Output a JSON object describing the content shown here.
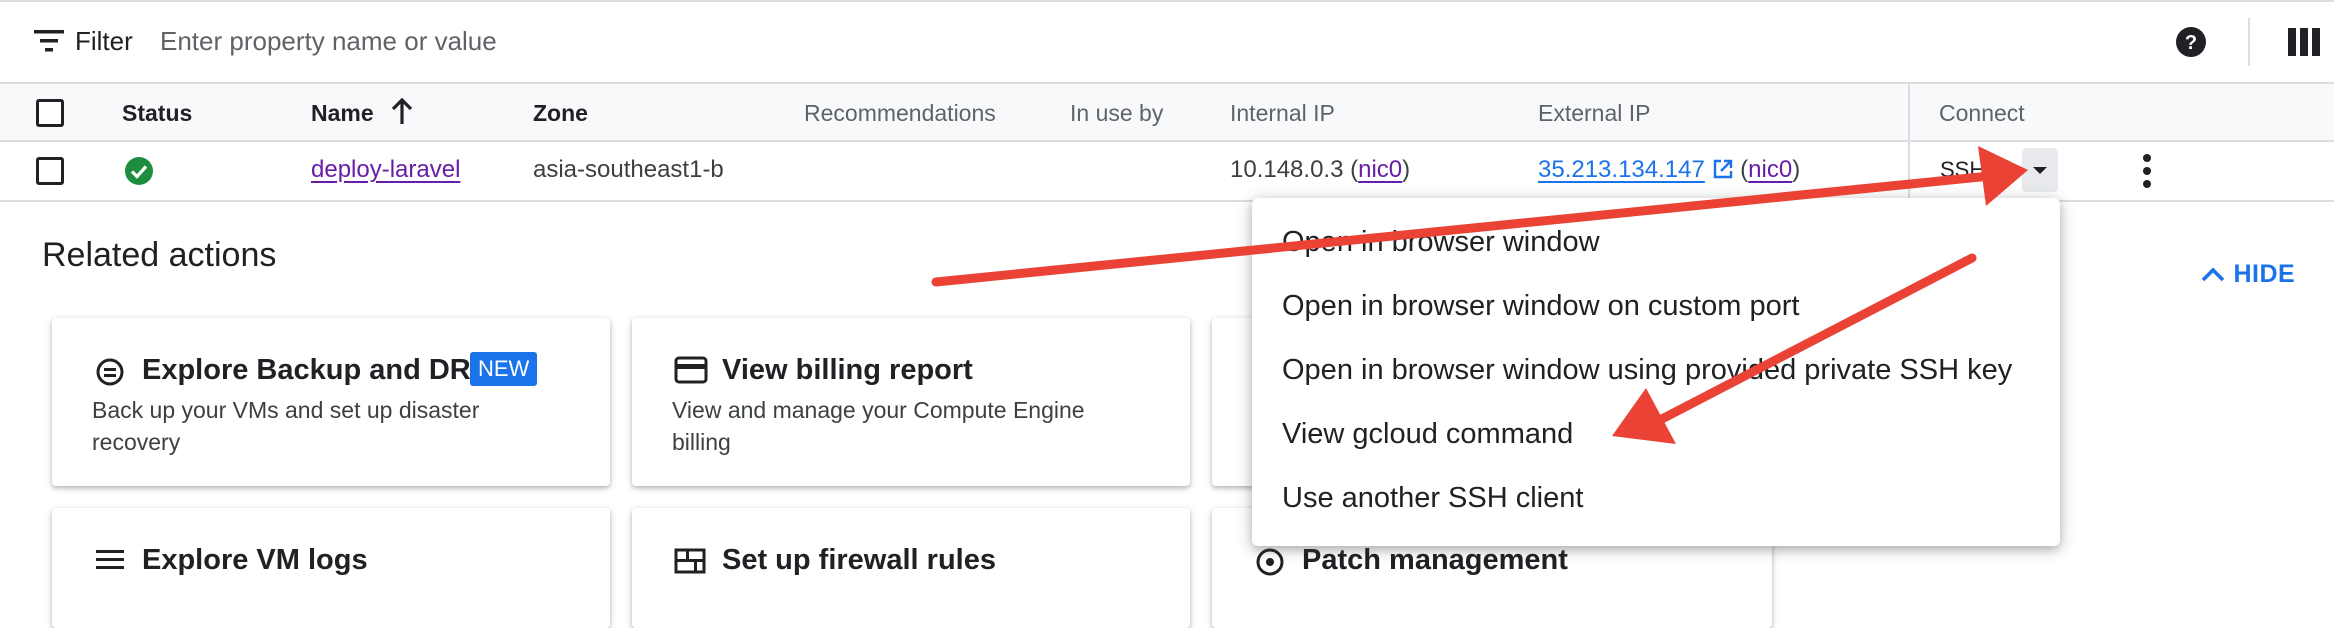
{
  "filter": {
    "label": "Filter",
    "placeholder": "Enter property name or value",
    "value": ""
  },
  "table": {
    "columns": {
      "status": "Status",
      "name": "Name",
      "zone": "Zone",
      "recommendations": "Recommendations",
      "in_use_by": "In use by",
      "internal_ip": "Internal IP",
      "external_ip": "External IP",
      "connect": "Connect"
    },
    "row": {
      "name": "deploy-laravel",
      "zone": "asia-southeast1-b",
      "internal_ip": "10.148.0.3",
      "internal_nic": "nic0",
      "external_ip": "35.213.134.147",
      "external_nic": "nic0",
      "connect": "SSH",
      "status_icon": "check-circle-icon"
    }
  },
  "related": {
    "title": "Related actions",
    "hide_label": "HIDE",
    "cards": [
      {
        "title": "Explore Backup and DR",
        "badge": "NEW",
        "desc": "Back up your VMs and set up disaster recovery",
        "icon": "backup-icon"
      },
      {
        "title": "View billing report",
        "desc": "View and manage your Compute Engine billing",
        "icon": "credit-card-icon"
      },
      {
        "title": "Explore VM logs",
        "icon": "list-icon"
      },
      {
        "title": "Set up firewall rules",
        "icon": "firewall-icon"
      },
      {
        "title": "Patch management",
        "icon": "patch-icon"
      }
    ]
  },
  "ssh_menu": {
    "items": [
      "Open in browser window",
      "Open in browser window on custom port",
      "Open in browser window using provided private SSH key",
      "View gcloud command",
      "Use another SSH client"
    ]
  },
  "colors": {
    "accent": "#1a73e8",
    "visited_link": "#681da8",
    "status_ok": "#1e8e3e",
    "annotation_arrow": "#ea4335"
  }
}
